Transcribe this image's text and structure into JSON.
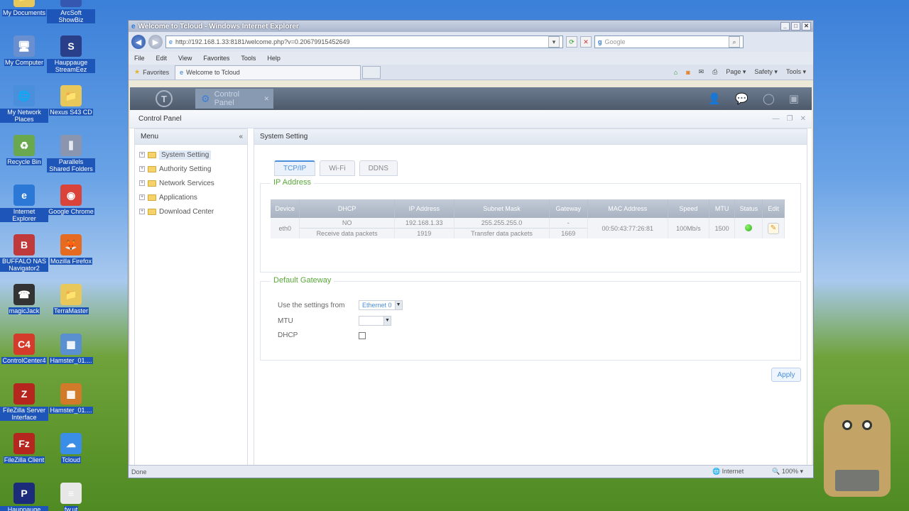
{
  "desktop": {
    "icons": [
      {
        "label": "My Documents",
        "glyph": "📁",
        "color": "#e8c85a"
      },
      {
        "label": "ArcSoft ShowBiz",
        "glyph": "S",
        "color": "#3557b0"
      },
      {
        "label": "My Computer",
        "glyph": "🖥",
        "color": "#6a8fd0"
      },
      {
        "label": "Hauppauge StreamEez",
        "glyph": "S",
        "color": "#2a3f8a"
      },
      {
        "label": "My Network Places",
        "glyph": "🌐",
        "color": "#4a8fdc"
      },
      {
        "label": "Nexus S43 CD",
        "glyph": "📁",
        "color": "#e8c85a"
      },
      {
        "label": "Recycle Bin",
        "glyph": "♻",
        "color": "#6aa84f"
      },
      {
        "label": "Parallels Shared Folders",
        "glyph": "⫼",
        "color": "#8a96b0"
      },
      {
        "label": "Internet Explorer",
        "glyph": "e",
        "color": "#2c78d6"
      },
      {
        "label": "Google Chrome",
        "glyph": "◉",
        "color": "#d9433a"
      },
      {
        "label": "BUFFALO NAS Navigator2",
        "glyph": "B",
        "color": "#c0393b"
      },
      {
        "label": "Mozilla Firefox",
        "glyph": "🦊",
        "color": "#e66a1f"
      },
      {
        "label": "magicJack",
        "glyph": "☎",
        "color": "#333"
      },
      {
        "label": "TerraMaster",
        "glyph": "📁",
        "color": "#e8c85a"
      },
      {
        "label": "ControlCenter4",
        "glyph": "C4",
        "color": "#d43b2b"
      },
      {
        "label": "Hamster_01....",
        "glyph": "▦",
        "color": "#5a8fd0"
      },
      {
        "label": "FileZilla Server Interface",
        "glyph": "Z",
        "color": "#b5261e"
      },
      {
        "label": "Hamster_01....",
        "glyph": "▦",
        "color": "#d07a2a"
      },
      {
        "label": "FileZilla Client",
        "glyph": "Fz",
        "color": "#b5261e"
      },
      {
        "label": "Tcloud",
        "glyph": "☁",
        "color": "#3a8ee6"
      },
      {
        "label": "Hauppauge Personal Lo...",
        "glyph": "P",
        "color": "#1c2b7a"
      },
      {
        "label": "fw.ut",
        "glyph": "≡",
        "color": "#e7e7e7"
      }
    ]
  },
  "browser": {
    "title": "Welcome to Tcloud - Windows Internet Explorer",
    "address": "http://192.168.1.33:8181/welcome.php?v=0.20679915452649",
    "search_placeholder": "Google",
    "menu": [
      "File",
      "Edit",
      "View",
      "Favorites",
      "Tools",
      "Help"
    ],
    "favorites_label": "Favorites",
    "tab_title": "Welcome to Tcloud",
    "commands": [
      "Page ▾",
      "Safety ▾",
      "Tools ▾"
    ],
    "status_text": "Done",
    "zone_text": "Internet",
    "zoom_text": "100%"
  },
  "app": {
    "logo": "T",
    "tab_label": "Control Panel",
    "panel_title": "Control Panel",
    "menu_title": "Menu",
    "menu_items": [
      {
        "label": "System Setting",
        "active": true
      },
      {
        "label": "Authority Setting",
        "active": false
      },
      {
        "label": "Network Services",
        "active": false
      },
      {
        "label": "Applications",
        "active": false
      },
      {
        "label": "Download Center",
        "active": false
      }
    ],
    "section_title": "System Setting",
    "subtabs": [
      "TCP/IP",
      "Wi-Fi",
      "DDNS"
    ],
    "ip_section_title": "IP Address",
    "ip_columns": [
      "Device",
      "DHCP",
      "IP Address",
      "Subnet Mask",
      "Gateway",
      "MAC Address",
      "Speed",
      "MTU",
      "Status",
      "Edit"
    ],
    "ip_row": {
      "device": "eth0",
      "dhcp": "NO",
      "ip": "192.168.1.33",
      "subnet": "255.255.255.0",
      "gateway": "-",
      "mac": "00:50:43:77:26:81",
      "speed": "100Mb/s",
      "mtu": "1500",
      "receive_label": "Receive data packets",
      "receive_value": "1919",
      "transfer_label": "Transfer data packets",
      "transfer_value": "1669"
    },
    "gateway_section_title": "Default Gateway",
    "use_settings_label": "Use the settings from",
    "use_settings_value": "Ethernet 0",
    "mtu_label": "MTU",
    "mtu_value": "",
    "dhcp_label": "DHCP",
    "apply_label": "Apply"
  }
}
